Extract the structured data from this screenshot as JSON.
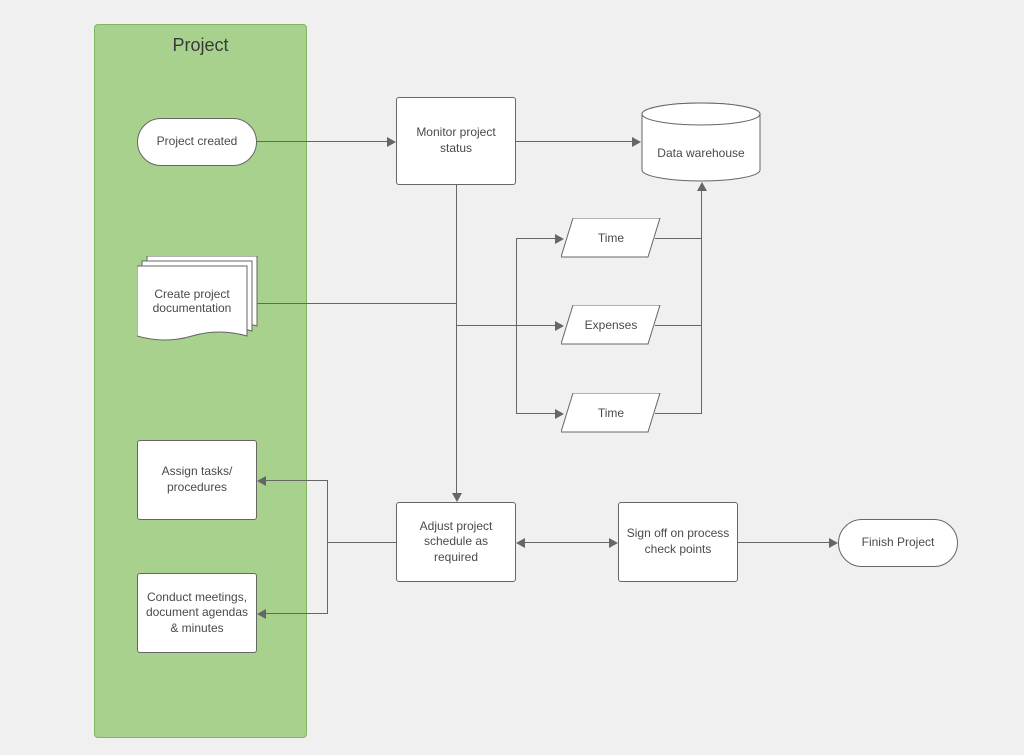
{
  "swimlane": {
    "title": "Project"
  },
  "nodes": {
    "project_created": "Project created",
    "monitor_status": "Monitor project status",
    "data_warehouse": "Data warehouse",
    "create_docs": "Create project documentation",
    "time1": "Time",
    "expenses": "Expenses",
    "time2": "Time",
    "assign_tasks": "Assign tasks/ procedures",
    "adjust_schedule": "Adjust project schedule as required",
    "sign_off": "Sign off on process check points",
    "finish_project": "Finish Project",
    "conduct_meetings": "Conduct meetings, document agendas & minutes"
  }
}
